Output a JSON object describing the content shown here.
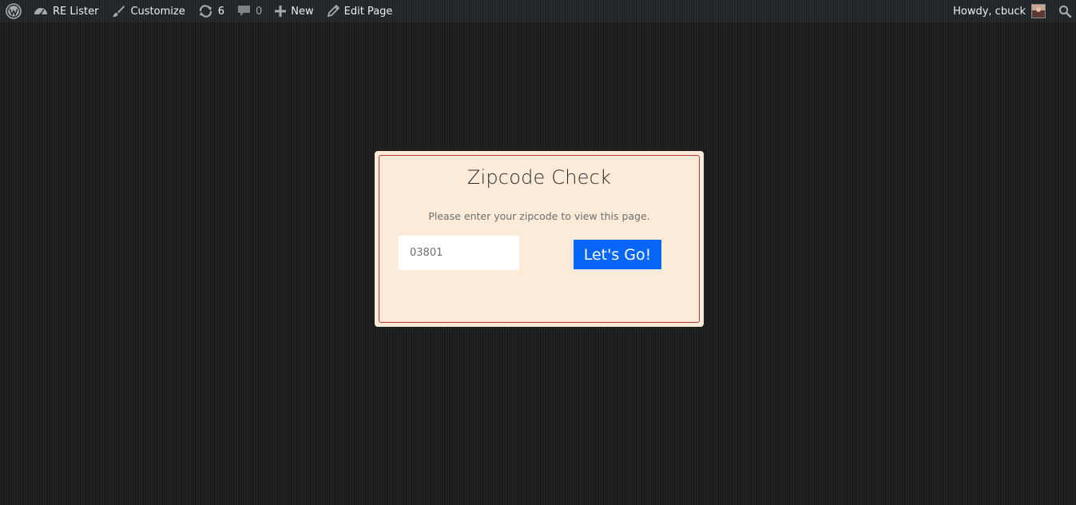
{
  "adminbar": {
    "wp_logo_icon": "wordpress-icon",
    "site": {
      "icon": "dashboard-icon",
      "label": "RE Lister"
    },
    "customize": {
      "icon": "brush-icon",
      "label": "Customize"
    },
    "updates": {
      "icon": "refresh-icon",
      "count": "6"
    },
    "comments": {
      "icon": "comment-icon",
      "count": "0"
    },
    "new": {
      "icon": "plus-icon",
      "label": "New"
    },
    "edit": {
      "icon": "pencil-icon",
      "label": "Edit Page"
    },
    "greeting": "Howdy, cbuck",
    "search_icon": "search-icon"
  },
  "modal": {
    "title": "Zipcode Check",
    "description": "Please enter your zipcode to view this page.",
    "zip_value": "03801",
    "button_label": "Let's Go!"
  },
  "colors": {
    "accent_button": "#0766f7",
    "modal_bg": "#fbebd8",
    "modal_border": "#c0392b",
    "adminbar_bg": "#23282d"
  }
}
